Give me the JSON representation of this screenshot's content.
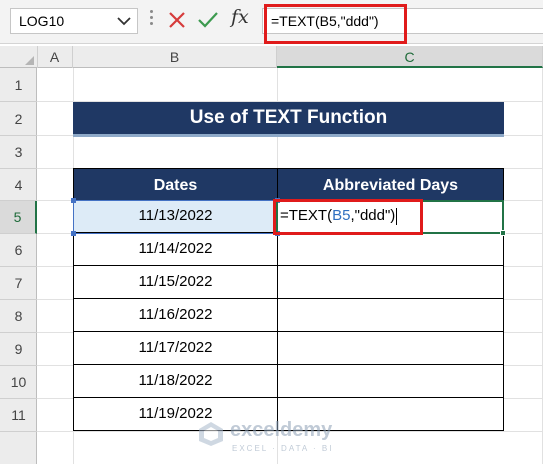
{
  "formula_bar": {
    "name_box": "LOG10",
    "formula": "=TEXT(B5,\"ddd\")",
    "fx": "fx"
  },
  "columns": [
    "A",
    "B",
    "C"
  ],
  "rows": [
    "1",
    "2",
    "3",
    "4",
    "5",
    "6",
    "7",
    "8",
    "9",
    "10",
    "11"
  ],
  "sheet": {
    "title": "Use of TEXT Function",
    "headers": [
      "Dates",
      "Abbreviated Days"
    ],
    "dates": [
      "11/13/2022",
      "11/14/2022",
      "11/15/2022",
      "11/16/2022",
      "11/17/2022",
      "11/18/2022",
      "11/19/2022"
    ],
    "edit_cell": {
      "prefix": "=TEXT(",
      "ref": "B5",
      "suffix": ",\"ddd\")"
    }
  },
  "watermark": {
    "name": "exceldemy",
    "tagline": "EXCEL · DATA · BI"
  },
  "colors": {
    "header_fill": "#1f3864",
    "excel_green": "#217346",
    "highlight_red": "#e01b1b",
    "active_fill": "#ddebf7",
    "ref_blue": "#4472c4"
  },
  "icons": [
    "chevron-down-icon",
    "cancel-icon",
    "enter-icon",
    "fx-icon",
    "exceldemy-logo-icon"
  ]
}
